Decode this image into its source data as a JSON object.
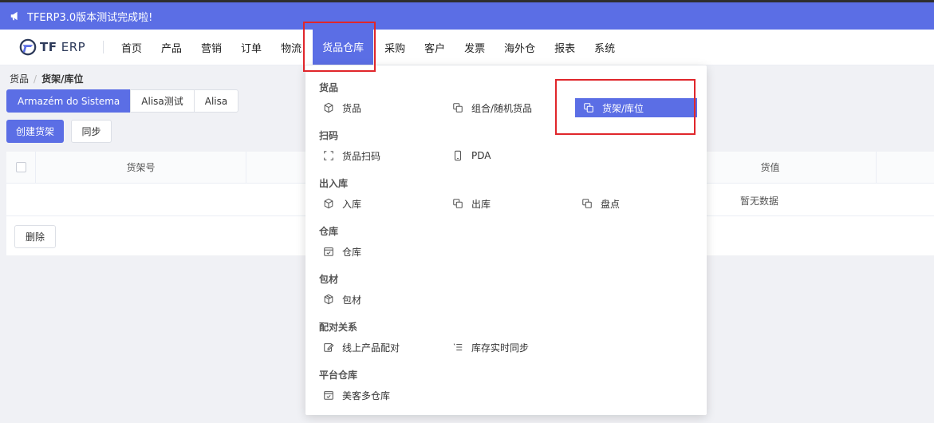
{
  "banner": {
    "text": "TFERP3.0版本测试完成啦!"
  },
  "logo": {
    "brand_bold": "TF",
    "brand_thin": " ERP"
  },
  "nav": {
    "items": [
      {
        "label": "首页"
      },
      {
        "label": "产品"
      },
      {
        "label": "营销"
      },
      {
        "label": "订单"
      },
      {
        "label": "物流"
      },
      {
        "label": "货品仓库"
      },
      {
        "label": "采购"
      },
      {
        "label": "客户"
      },
      {
        "label": "发票"
      },
      {
        "label": "海外仓"
      },
      {
        "label": "报表"
      },
      {
        "label": "系统"
      }
    ],
    "active_index": 5
  },
  "breadcrumb": {
    "root": "货品",
    "sep": "/",
    "current": "货架/库位"
  },
  "warehouse_tabs": [
    "Armazém do Sistema",
    "Alisa测试",
    "Alisa"
  ],
  "actions": {
    "create": "创建货架",
    "sync": "同步",
    "delete": "删除"
  },
  "table": {
    "headers": [
      "货架号",
      "货值"
    ],
    "empty_text": "暂无数据"
  },
  "dropdown": {
    "sections": [
      {
        "title": "货品",
        "items": [
          {
            "label": "货品",
            "icon": "cube-icon"
          },
          {
            "label": "组合/随机货品",
            "icon": "copy-icon"
          },
          {
            "label": "货架/库位",
            "icon": "copy-icon",
            "selected": true
          }
        ]
      },
      {
        "title": "扫码",
        "items": [
          {
            "label": "货品扫码",
            "icon": "scan-icon"
          },
          {
            "label": "PDA",
            "icon": "phone-icon"
          }
        ]
      },
      {
        "title": "出入库",
        "items": [
          {
            "label": "入库",
            "icon": "cube-icon"
          },
          {
            "label": "出库",
            "icon": "copy-icon"
          },
          {
            "label": "盘点",
            "icon": "copy-icon"
          }
        ]
      },
      {
        "title": "仓库",
        "items": [
          {
            "label": "仓库",
            "icon": "calendar-check-icon"
          }
        ]
      },
      {
        "title": "包材",
        "items": [
          {
            "label": "包材",
            "icon": "box-icon"
          }
        ]
      },
      {
        "title": "配对关系",
        "items": [
          {
            "label": "线上产品配对",
            "icon": "edit-icon"
          },
          {
            "label": "库存实时同步",
            "icon": "list-icon"
          }
        ]
      },
      {
        "title": "平台仓库",
        "items": [
          {
            "label": "美客多仓库",
            "icon": "calendar-check-icon"
          }
        ]
      }
    ]
  },
  "colors": {
    "accent": "#5b6ee5",
    "highlight_border": "#e0262b"
  }
}
